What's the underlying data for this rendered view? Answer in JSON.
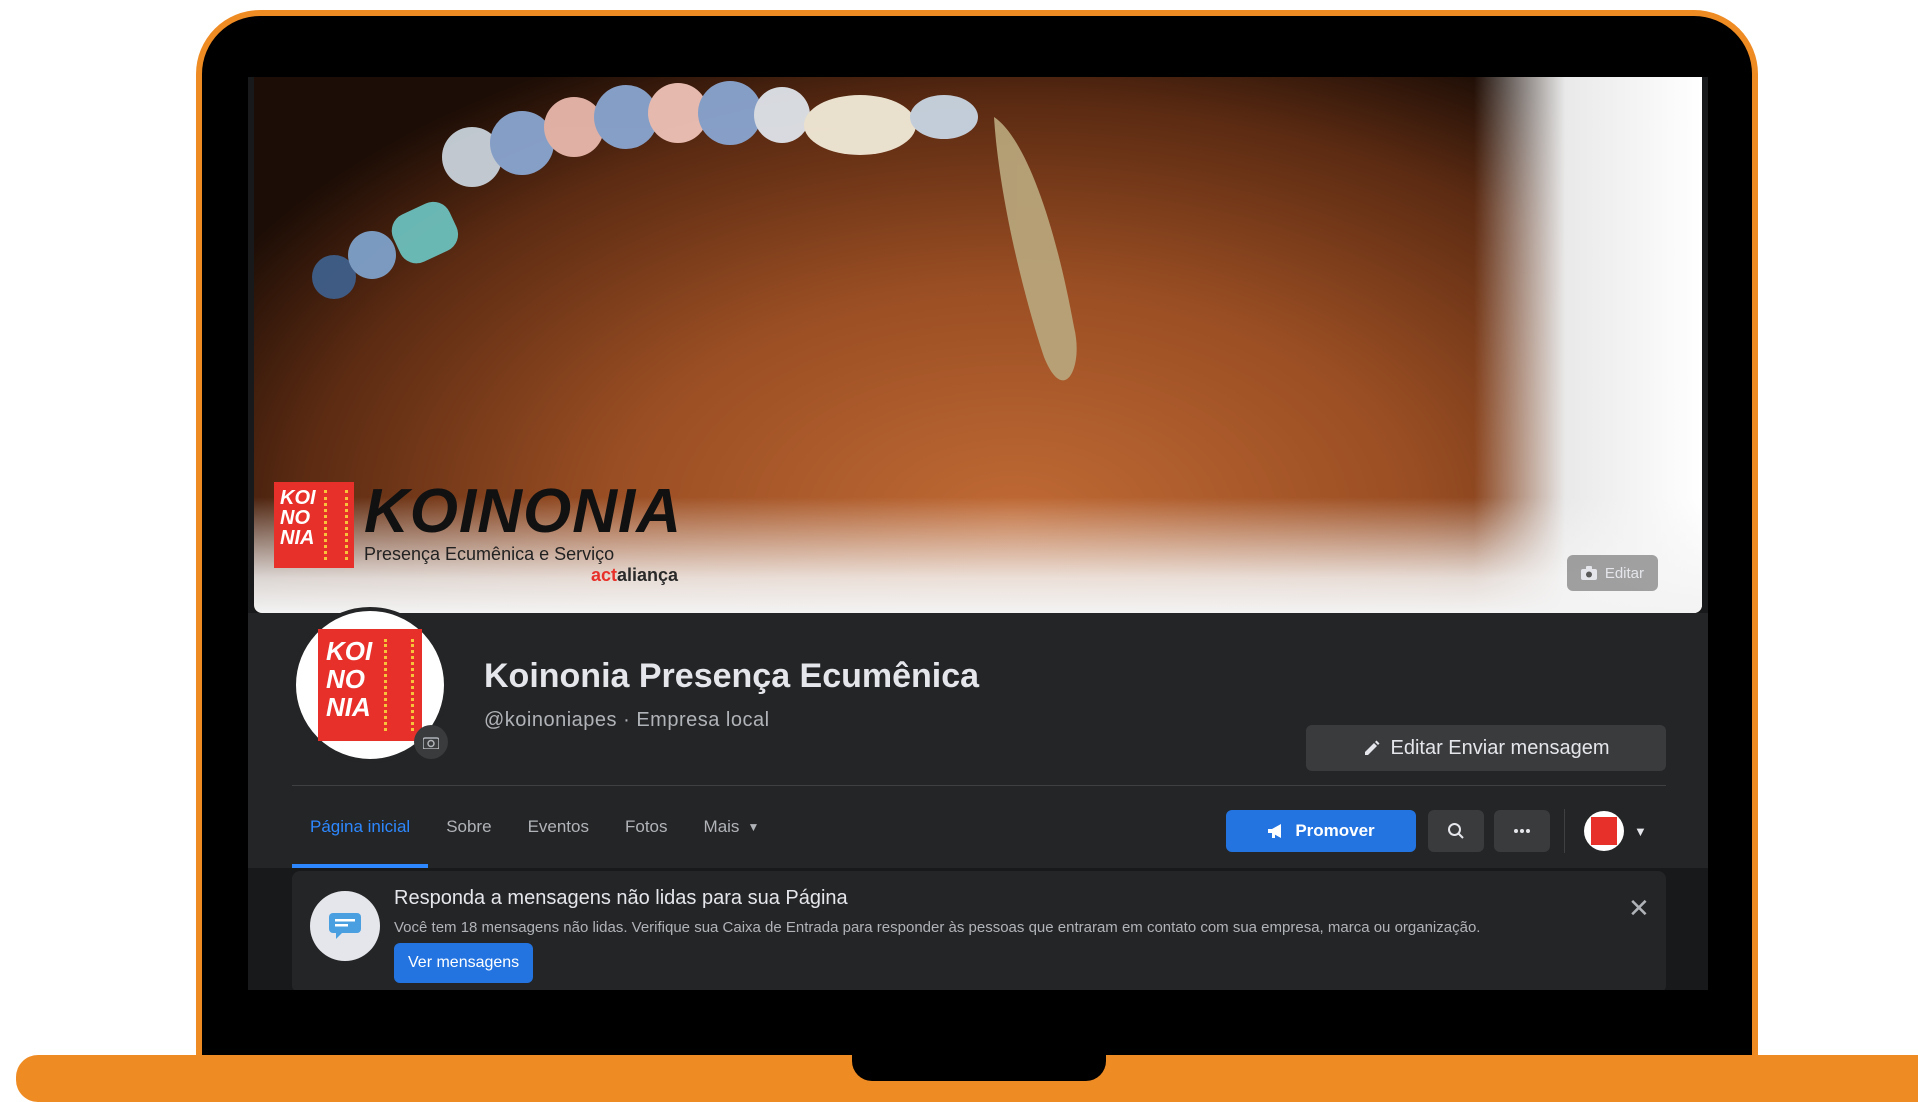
{
  "cover": {
    "logo_square": "KOI\nNO\nNIA",
    "logo_word": "KOINONIA",
    "logo_sub": "Presença Ecumênica e Serviço",
    "logo_act_a": "act",
    "logo_act_b": "aliança",
    "edit_label": "Editar"
  },
  "profile": {
    "avatar_logo": "KOI\nNO\nNIA",
    "title": "Koinonia Presença Ecumênica",
    "handle": "@koinoniapes · Empresa local",
    "edit_message_label": "Editar Enviar mensagem"
  },
  "tabs": [
    {
      "label": "Página inicial",
      "active": true
    },
    {
      "label": "Sobre"
    },
    {
      "label": "Eventos"
    },
    {
      "label": "Fotos"
    },
    {
      "label": "Mais"
    }
  ],
  "actions": {
    "promote_label": "Promover"
  },
  "notice": {
    "title": "Responda a mensagens não lidas para sua Página",
    "body": "Você tem 18 mensagens não lidas. Verifique sua Caixa de Entrada para responder às pessoas que entraram em contato com sua empresa, marca ou organização.",
    "button_label": "Ver mensagens"
  },
  "colors": {
    "frame": "#ef8b23",
    "accent": "#2374e1",
    "brand_red": "#e8302a"
  }
}
